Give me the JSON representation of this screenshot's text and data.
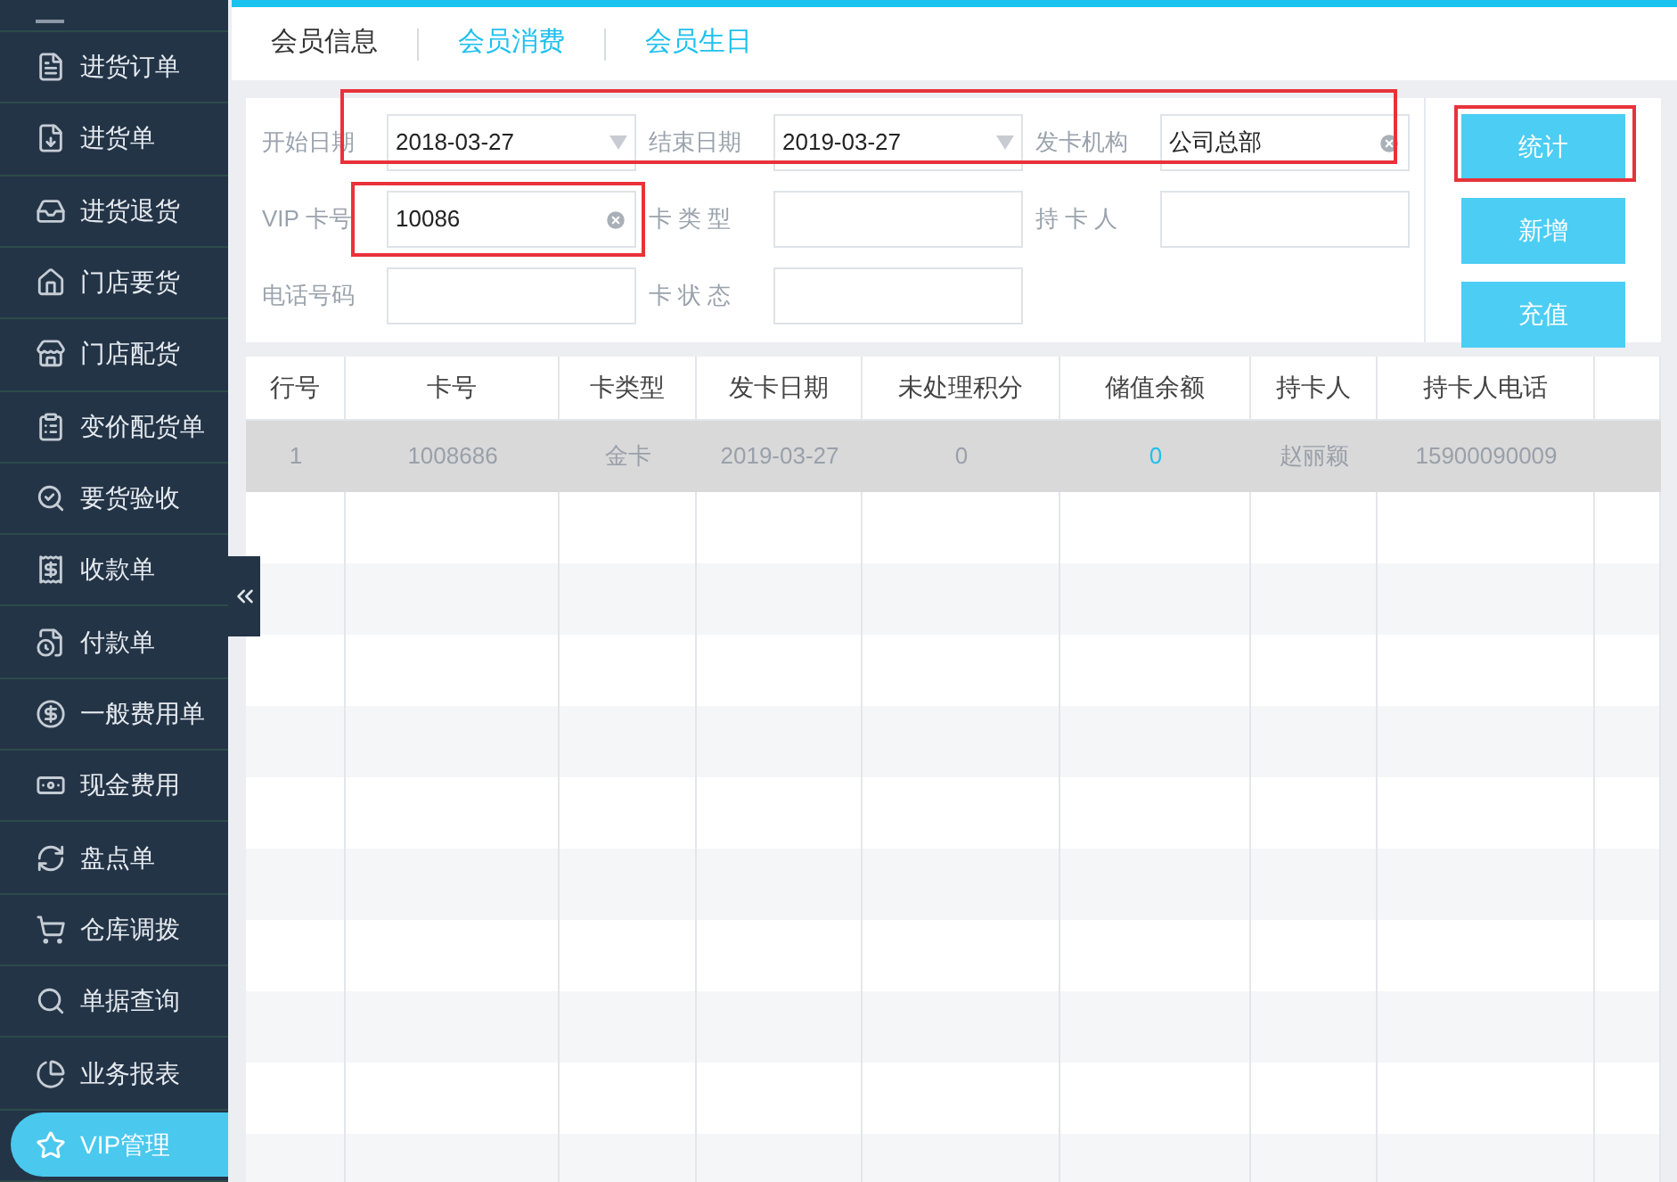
{
  "sidebar": {
    "items": [
      {
        "label": "进货订单",
        "selected": false
      },
      {
        "label": "进货单",
        "selected": false
      },
      {
        "label": "进货退货",
        "selected": false
      },
      {
        "label": "门店要货",
        "selected": false
      },
      {
        "label": "门店配货",
        "selected": false
      },
      {
        "label": "变价配货单",
        "selected": false
      },
      {
        "label": "要货验收",
        "selected": false
      },
      {
        "label": "收款单",
        "selected": false
      },
      {
        "label": "付款单",
        "selected": false
      },
      {
        "label": "一般费用单",
        "selected": false
      },
      {
        "label": "现金费用",
        "selected": false
      },
      {
        "label": "盘点单",
        "selected": false
      },
      {
        "label": "仓库调拨",
        "selected": false
      },
      {
        "label": "单据查询",
        "selected": false
      },
      {
        "label": "业务报表",
        "selected": false
      },
      {
        "label": "VIP管理",
        "selected": true
      }
    ]
  },
  "tabs": [
    {
      "label": "会员信息",
      "selected": true
    },
    {
      "label": "会员消费",
      "selected": false
    },
    {
      "label": "会员生日",
      "selected": false
    }
  ],
  "filters": {
    "rows": [
      {
        "highlighted": true,
        "fields": [
          {
            "label": "开始日期",
            "value": "2018-03-27",
            "kind": "date",
            "highlighted": false
          },
          {
            "label": "结束日期",
            "value": "2019-03-27",
            "kind": "date",
            "highlighted": false
          },
          {
            "label": "发卡机构",
            "value": "公司总部",
            "kind": "clearable",
            "highlighted": false
          }
        ]
      },
      {
        "highlighted": false,
        "fields": [
          {
            "label": "VIP 卡号",
            "value": "10086",
            "kind": "clearable",
            "highlighted": true
          },
          {
            "label": "卡 类 型",
            "kind": "text",
            "highlighted": false
          },
          {
            "label": "持 卡 人",
            "kind": "text",
            "highlighted": false
          }
        ]
      },
      {
        "highlighted": false,
        "fields": [
          {
            "label": "电话号码",
            "kind": "text",
            "highlighted": false
          },
          {
            "label": "卡 状 态",
            "kind": "text",
            "highlighted": false
          }
        ]
      }
    ],
    "buttons": [
      {
        "label": "统计",
        "highlighted": true
      },
      {
        "label": "新增",
        "highlighted": false
      },
      {
        "label": "充值",
        "highlighted": false
      }
    ]
  },
  "table": {
    "columns": [
      "行号",
      "卡号",
      "卡类型",
      "发卡日期",
      "未处理积分",
      "储值余额",
      "持卡人",
      "持卡人电话",
      ""
    ],
    "rows": [
      {
        "selected": true,
        "cells": [
          "1",
          "1008686",
          "金卡",
          "2019-03-27",
          "0",
          "0",
          "赵丽颖",
          "15900090009",
          ""
        ]
      }
    ]
  }
}
